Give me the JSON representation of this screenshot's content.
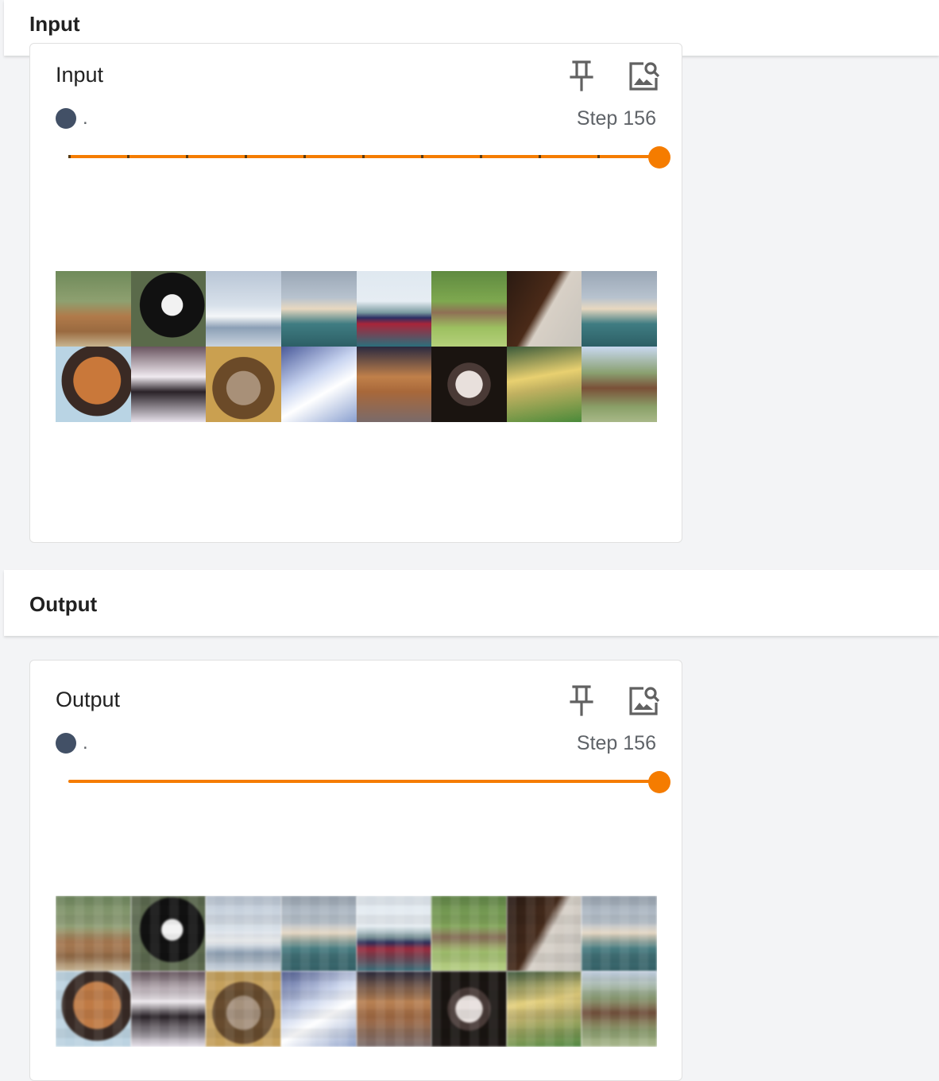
{
  "colors": {
    "accent": "#f57c00",
    "run_dot": "#425066"
  },
  "sections": [
    {
      "header": "Input",
      "card": {
        "title": "Input",
        "pin_icon": "pin-icon",
        "image_search_icon": "image-search-icon",
        "run_name": ".",
        "step_label": "Step 156",
        "slider_value_fraction": 1.0,
        "slider_tick_count": 10,
        "images": [
          "horse-rider",
          "black-white-dog",
          "boat",
          "airplane",
          "ship",
          "deer",
          "horse-head",
          "airplane",
          "cat-sleeping",
          "dog-longhair",
          "cat-tabby",
          "boat-white",
          "cat-orange",
          "dog-puppy",
          "car-yellow",
          "horse"
        ]
      }
    },
    {
      "header": "Output",
      "card": {
        "title": "Output",
        "pin_icon": "pin-icon",
        "image_search_icon": "image-search-icon",
        "run_name": ".",
        "step_label": "Step 156",
        "slider_value_fraction": 1.0,
        "slider_tick_count": 0,
        "images": [
          "horse-rider",
          "black-white-dog",
          "boat",
          "airplane",
          "ship",
          "deer",
          "horse-head",
          "airplane",
          "cat-sleeping",
          "dog-longhair",
          "cat-tabby",
          "boat-white",
          "cat-orange",
          "dog-puppy",
          "car-yellow",
          "horse"
        ]
      }
    }
  ]
}
